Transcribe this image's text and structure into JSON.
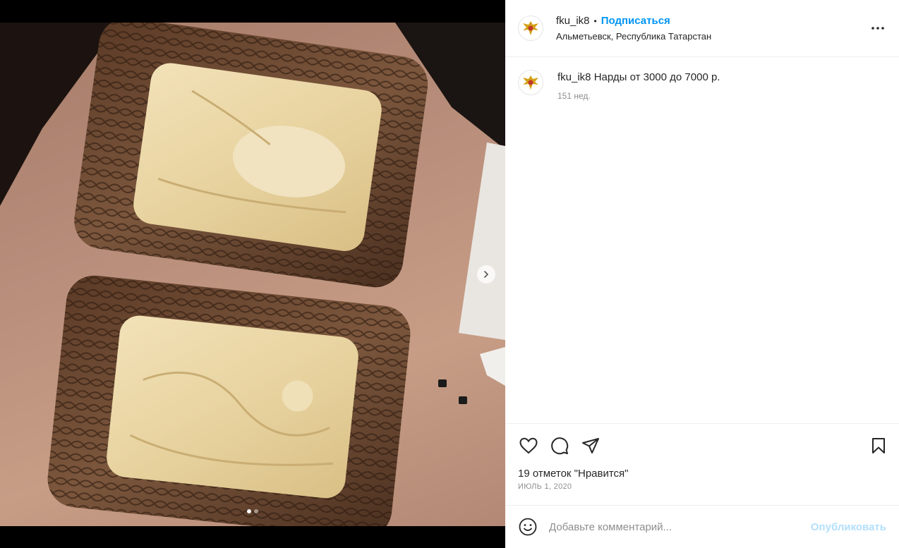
{
  "post": {
    "username": "fku_ik8",
    "separator": "•",
    "follow_label": "Подписаться",
    "location": "Альметьевск, Республика Татарстан",
    "more_icon": "more-horizontal-icon"
  },
  "caption": {
    "username": "fku_ik8",
    "text": "Нарды от 3000 до 7000 р.",
    "time": "151 нед."
  },
  "actions": {
    "like_icon": "heart-icon",
    "comment_icon": "comment-icon",
    "share_icon": "send-icon",
    "save_icon": "bookmark-icon"
  },
  "likes_text": "19 отметок \"Нравится\"",
  "date_text": "ИЮЛЬ 1, 2020",
  "comment_box": {
    "placeholder": "Добавьте комментарий...",
    "publish_label": "Опубликовать",
    "emoji_icon": "emoji-icon"
  },
  "carousel": {
    "current_slide": 1,
    "total_slides": 2
  },
  "colors": {
    "accent": "#0095f6",
    "publish_disabled": "#b2dffc",
    "text": "#262626",
    "muted": "#8e8e8e"
  }
}
